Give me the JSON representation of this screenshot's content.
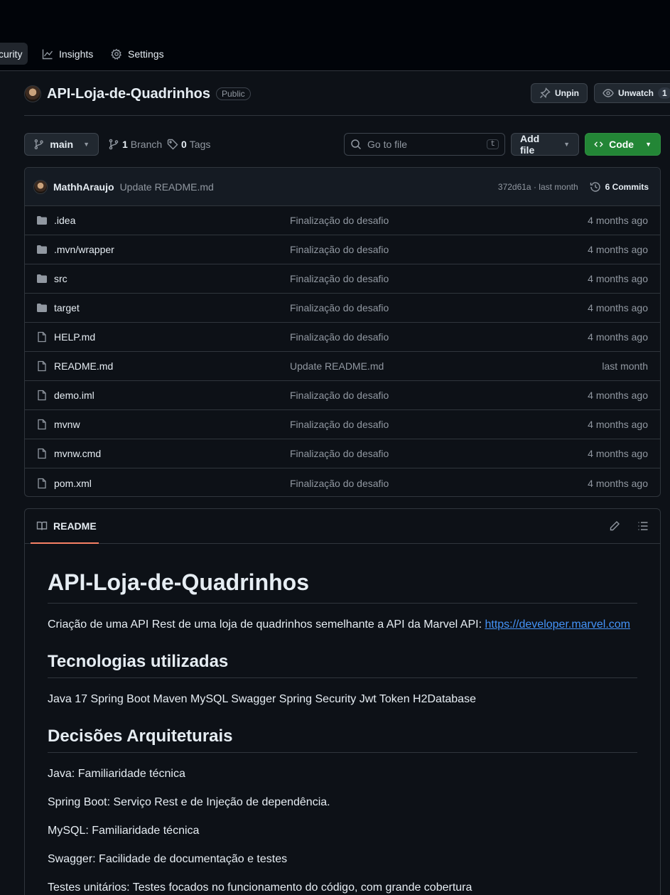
{
  "nav": {
    "tabs": [
      {
        "label": "curity",
        "icon": "shield-icon",
        "active": true
      },
      {
        "label": "Insights",
        "icon": "graph-icon"
      },
      {
        "label": "Settings",
        "icon": "gear-icon"
      }
    ]
  },
  "repo": {
    "name": "API-Loja-de-Quadrinhos",
    "visibility": "Public",
    "unpin_label": "Unpin",
    "unwatch_label": "Unwatch",
    "watch_count": "1"
  },
  "toolbar": {
    "branch": "main",
    "branch_count": "1",
    "branch_label": "Branch",
    "tag_count": "0",
    "tag_label": "Tags",
    "search_placeholder": "Go to file",
    "search_shortcut": "t",
    "add_file_label": "Add file",
    "code_label": "Code"
  },
  "latest_commit": {
    "author": "MathhAraujo",
    "message": "Update README.md",
    "sha_time": "372d61a · last month",
    "commits_label": "6 Commits"
  },
  "files": [
    {
      "name": ".idea",
      "type": "dir",
      "message": "Finalização do desafio",
      "age": "4 months ago"
    },
    {
      "name": ".mvn/wrapper",
      "type": "dir",
      "message": "Finalização do desafio",
      "age": "4 months ago"
    },
    {
      "name": "src",
      "type": "dir",
      "message": "Finalização do desafio",
      "age": "4 months ago"
    },
    {
      "name": "target",
      "type": "dir",
      "message": "Finalização do desafio",
      "age": "4 months ago"
    },
    {
      "name": "HELP.md",
      "type": "file",
      "message": "Finalização do desafio",
      "age": "4 months ago"
    },
    {
      "name": "README.md",
      "type": "file",
      "message": "Update README.md",
      "age": "last month"
    },
    {
      "name": "demo.iml",
      "type": "file",
      "message": "Finalização do desafio",
      "age": "4 months ago"
    },
    {
      "name": "mvnw",
      "type": "file",
      "message": "Finalização do desafio",
      "age": "4 months ago"
    },
    {
      "name": "mvnw.cmd",
      "type": "file",
      "message": "Finalização do desafio",
      "age": "4 months ago"
    },
    {
      "name": "pom.xml",
      "type": "file",
      "message": "Finalização do desafio",
      "age": "4 months ago"
    }
  ],
  "readme": {
    "tab_label": "README",
    "title": "API-Loja-de-Quadrinhos",
    "intro": "Criação de uma API Rest de uma loja de quadrinhos semelhante a API da Marvel API: ",
    "intro_link": "https://developer.marvel.com",
    "h_tech": "Tecnologias utilizadas",
    "tech": "Java 17 Spring Boot Maven MySQL Swagger Spring Security Jwt Token H2Database",
    "h_arch": "Decisões Arquiteturais",
    "decisions": [
      "Java: Familiaridade técnica",
      "Spring Boot: Serviço Rest e de Injeção de dependência.",
      "MySQL: Familiaridade técnica",
      "Swagger: Facilidade de documentação e testes",
      "Testes unitários: Testes focados no funcionamento do código, com grande cobertura"
    ]
  }
}
